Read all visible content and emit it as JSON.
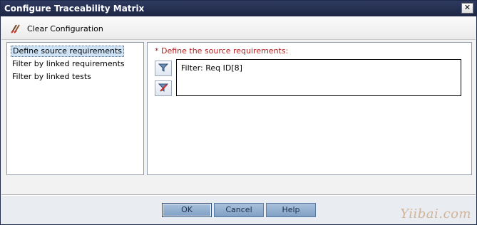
{
  "window": {
    "title": "Configure Traceability Matrix",
    "close_icon": "close-icon"
  },
  "toolbar": {
    "clear_label": "Clear Configuration",
    "clear_icon": "brush-icon"
  },
  "sidebar": {
    "items": [
      {
        "label": "Define source requirements",
        "selected": true
      },
      {
        "label": "Filter by linked requirements",
        "selected": false
      },
      {
        "label": "Filter by linked tests",
        "selected": false
      }
    ]
  },
  "main": {
    "section_label": "* Define the source requirements:",
    "filter_button_icon": "filter-icon",
    "clear_filter_button_icon": "clear-filter-icon",
    "filter_text": "Filter: Req ID[8]"
  },
  "footer": {
    "ok_label": "OK",
    "cancel_label": "Cancel",
    "help_label": "Help"
  },
  "watermark": "Yiibai.com",
  "colors": {
    "titlebar": "#1d2644",
    "required_label": "#b11e1e",
    "button_blue": "#8eaacb",
    "selection": "#cfe3f7"
  }
}
